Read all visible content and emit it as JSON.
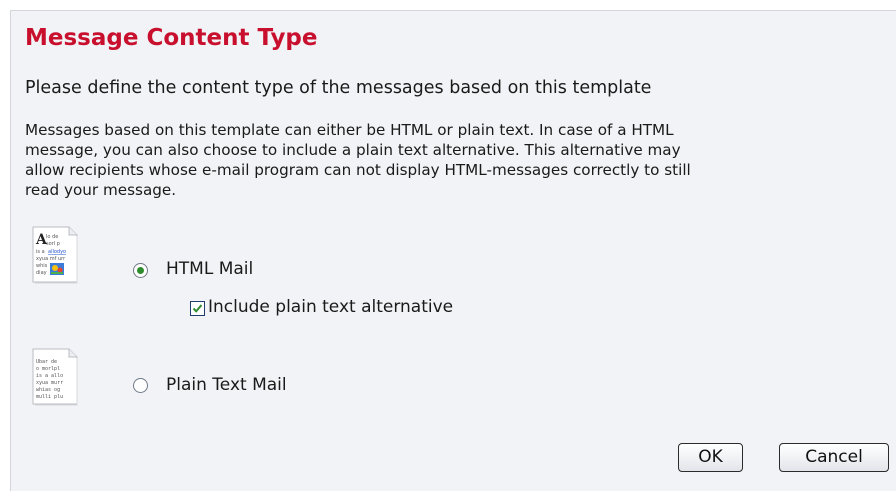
{
  "dialog": {
    "title": "Message Content Type",
    "subtitle": "Please define the content type of the messages based on this template",
    "description_lines": [
      "Messages based on this template can either be HTML or plain text. In case of a HTML",
      "message, you can also choose to include a plain text alternative. This alternative may",
      "allow recipients whose e-mail program can not display HTML-messages correctly to still",
      "read your message."
    ]
  },
  "options": {
    "html_mail": {
      "label": "HTML Mail",
      "selected": true,
      "icon": "html-document-icon",
      "icon_text": [
        "lo de",
        "sorl p",
        "is a",
        "allodyo",
        "xyua mf urr",
        "whis",
        "diay"
      ]
    },
    "plain_text_alternative": {
      "label": "Include plain text alternative",
      "checked": true
    },
    "plain_text_mail": {
      "label": "Plain Text Mail",
      "selected": false,
      "icon": "text-document-icon",
      "icon_text": [
        "Ubar de",
        "o morlpl",
        "is a allo",
        "xyua murr",
        "whias og",
        "mulli plu"
      ]
    }
  },
  "buttons": {
    "ok_label": "OK",
    "cancel_label": "Cancel"
  },
  "colors": {
    "title": "#c8102e",
    "background": "#f2f3f6",
    "radio_selected": "#2e8b2e",
    "check": "#2e8b2e"
  }
}
